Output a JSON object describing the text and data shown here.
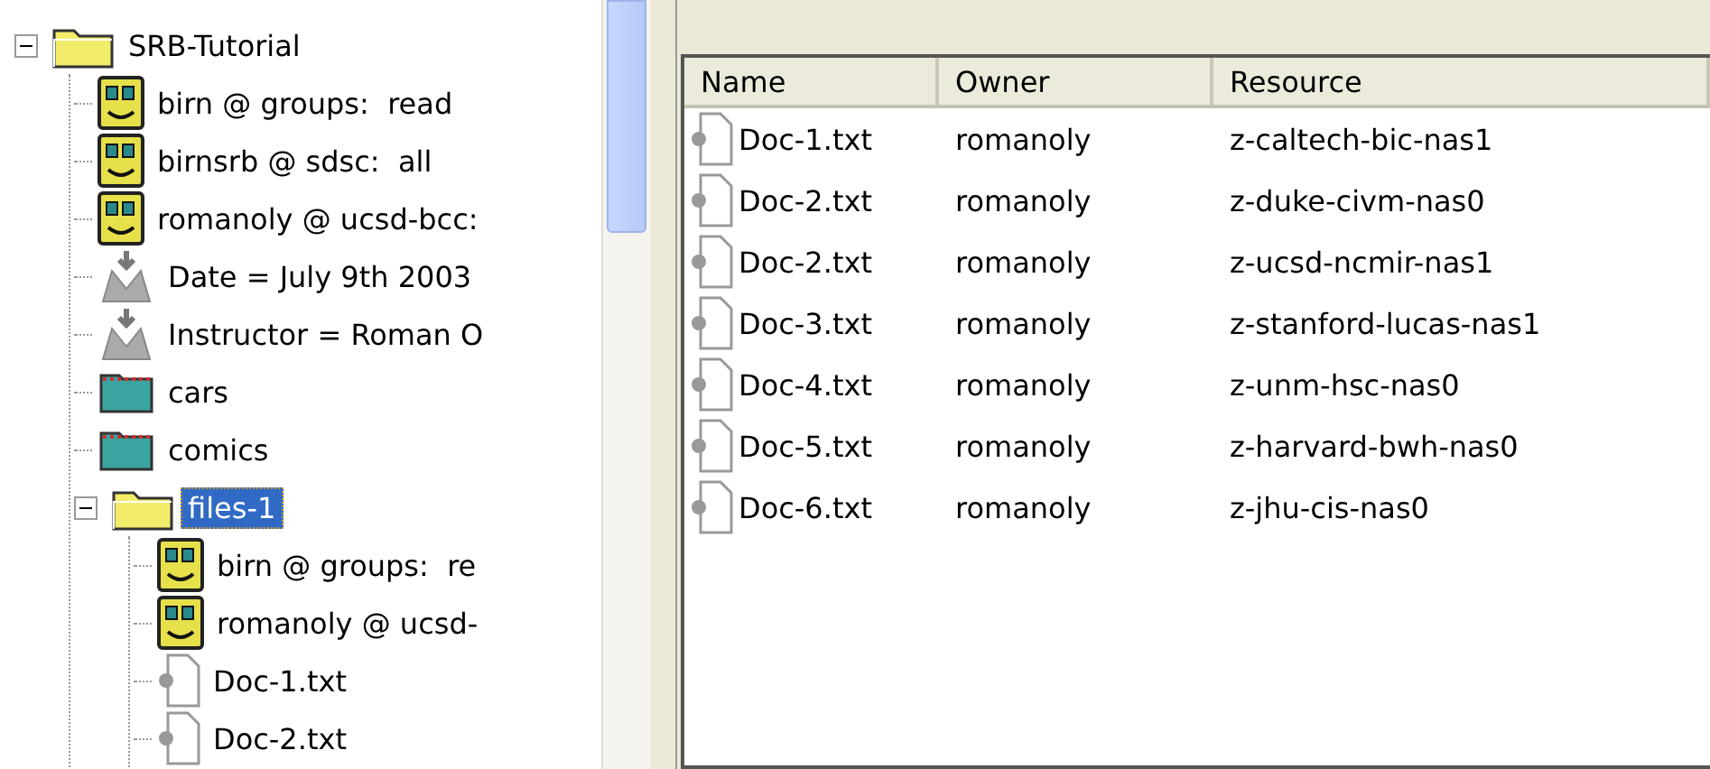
{
  "tree": [
    {
      "kind": "folder",
      "label": "SRB-Tutorial",
      "expanded": true,
      "selected": false,
      "children": [
        {
          "kind": "user",
          "label": "birn @ groups:  read",
          "selected": false
        },
        {
          "kind": "user",
          "label": "birnsrb @ sdsc:  all",
          "selected": false
        },
        {
          "kind": "user",
          "label": "romanoly @ ucsd-bcc:",
          "selected": false
        },
        {
          "kind": "meta",
          "label": "Date = July 9th 2003",
          "selected": false
        },
        {
          "kind": "meta",
          "label": "Instructor = Roman O",
          "selected": false
        },
        {
          "kind": "collection",
          "label": "cars",
          "selected": false
        },
        {
          "kind": "collection",
          "label": "comics",
          "selected": false
        },
        {
          "kind": "folder",
          "label": "files-1",
          "expanded": true,
          "selected": true,
          "children": [
            {
              "kind": "user",
              "label": "birn @ groups:  re",
              "selected": false
            },
            {
              "kind": "user",
              "label": "romanoly @ ucsd-",
              "selected": false
            },
            {
              "kind": "file",
              "label": "Doc-1.txt",
              "selected": false
            },
            {
              "kind": "file",
              "label": "Doc-2.txt",
              "selected": false
            }
          ]
        }
      ]
    }
  ],
  "table": {
    "columns": [
      "Name",
      "Owner",
      "Resource"
    ],
    "rows": [
      [
        "Doc-1.txt",
        "romanoly",
        "z-caltech-bic-nas1"
      ],
      [
        "Doc-2.txt",
        "romanoly",
        "z-duke-civm-nas0"
      ],
      [
        "Doc-2.txt",
        "romanoly",
        "z-ucsd-ncmir-nas1"
      ],
      [
        "Doc-3.txt",
        "romanoly",
        "z-stanford-lucas-nas1"
      ],
      [
        "Doc-4.txt",
        "romanoly",
        "z-unm-hsc-nas0"
      ],
      [
        "Doc-5.txt",
        "romanoly",
        "z-harvard-bwh-nas0"
      ],
      [
        "Doc-6.txt",
        "romanoly",
        "z-jhu-cis-nas0"
      ]
    ]
  }
}
